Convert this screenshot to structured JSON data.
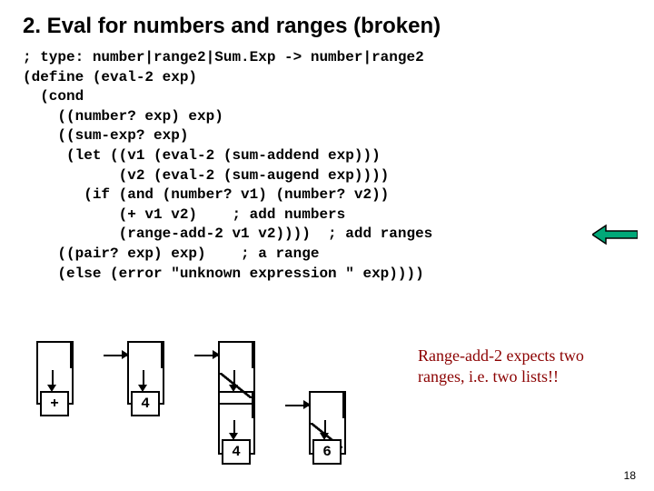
{
  "title": "2. Eval for numbers and ranges (broken)",
  "code": {
    "l1": "; type: number|range2|Sum.Exp -> number|range2",
    "l2": "(define (eval-2 exp)",
    "l3": "  (cond",
    "l4": "    ((number? exp) exp)",
    "l5": "    ((sum-exp? exp)",
    "l6": "     (let ((v1 (eval-2 (sum-addend exp)))",
    "l7": "           (v2 (eval-2 (sum-augend exp))))",
    "l8": "       (if (and (number? v1) (number? v2))",
    "l9": "           (+ v1 v2)    ; add numbers",
    "l10": "           (range-add-2 v1 v2))))  ; add ranges",
    "l11": "    ((pair? exp) exp)    ; a range",
    "l12": "    (else (error \"unknown expression \" exp))))"
  },
  "comment": "Range-add-2 expects two ranges, i.e. two lists!!",
  "diagram": {
    "v_plus": "+",
    "v_4a": "4",
    "v_4b": "4",
    "v_6": "6"
  },
  "pagenum": "18"
}
